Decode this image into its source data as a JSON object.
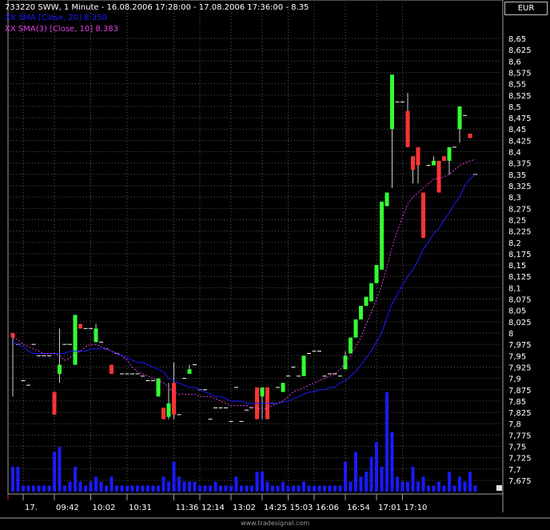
{
  "legend": {
    "title": "733220  SWW, 1 Minute - 16.08.2006 17:28:00 - 17.08.2006 17:36:00 - 8.35",
    "sma20": "XX SMA [Close, 20] 8.350",
    "sma10": "XX SMA(3) [Close, 10] 8.383"
  },
  "currency": "EUR",
  "watermark": "www.tradesignal.com",
  "colors": {
    "background": "#000000",
    "up": "#33ff33",
    "down": "#ff3333",
    "volume": "#1a1aff",
    "sma20": "#1a1aff",
    "sma10": "#e040e0",
    "grid": "#5a5a5a"
  },
  "chart_data": {
    "type": "candlestick",
    "title": "733220  SWW, 1 Minute - 16.08.2006 17:28:00 - 17.08.2006 17:36:00 - 8.35",
    "y_ticks": [
      "8,65",
      "8,625",
      "8,6",
      "8,575",
      "8,55",
      "8,525",
      "8,5",
      "8,475",
      "8,45",
      "8,425",
      "8,4",
      "8,375",
      "8,35",
      "8,325",
      "8,3",
      "8,275",
      "8,25",
      "8,225",
      "8,2",
      "8,175",
      "8,15",
      "8,125",
      "8,1",
      "8,075",
      "8,05",
      "8,025",
      "8",
      "7,975",
      "7,95",
      "7,925",
      "7,9",
      "7,875",
      "7,85",
      "7,825",
      "7,8",
      "7,775",
      "7,75",
      "7,725",
      "7,7",
      "7,675"
    ],
    "ylim": [
      7.66,
      8.67
    ],
    "x_ticks": [
      {
        "label": "17.",
        "index": 2
      },
      {
        "label": "09:42",
        "index": 8
      },
      {
        "label": "10:02",
        "index": 15
      },
      {
        "label": "10:31",
        "index": 22
      },
      {
        "label": "11:36",
        "index": 31
      },
      {
        "label": "12:14",
        "index": 36
      },
      {
        "label": "13:02",
        "index": 42
      },
      {
        "label": "14:25",
        "index": 48
      },
      {
        "label": "15:03",
        "index": 53
      },
      {
        "label": "16:06",
        "index": 58
      },
      {
        "label": "16:54",
        "index": 64
      },
      {
        "label": "17:01",
        "index": 70
      },
      {
        "label": "17:10",
        "index": 75
      }
    ],
    "candles": [
      [
        8.0,
        8.0,
        7.86,
        7.99
      ],
      [
        7.975,
        7.975,
        7.975,
        7.975
      ],
      [
        7.895,
        7.895,
        7.895,
        7.895
      ],
      [
        7.885,
        7.885,
        7.885,
        7.885
      ],
      [
        7.975,
        7.975,
        7.975,
        7.975
      ],
      [
        7.95,
        7.95,
        7.95,
        7.95
      ],
      [
        7.95,
        7.95,
        7.95,
        7.95
      ],
      [
        7.95,
        7.95,
        7.95,
        7.95
      ],
      [
        7.87,
        7.87,
        7.82,
        7.82
      ],
      [
        7.91,
        8.01,
        7.89,
        7.93
      ],
      [
        7.975,
        7.975,
        7.975,
        7.975
      ],
      [
        7.975,
        7.975,
        7.975,
        7.975
      ],
      [
        7.93,
        8.04,
        7.93,
        8.04
      ],
      [
        8.02,
        8.02,
        8.01,
        8.01
      ],
      [
        8.01,
        8.01,
        8.01,
        8.01
      ],
      [
        8.01,
        8.01,
        8.01,
        8.01
      ],
      [
        7.98,
        8.02,
        7.98,
        8.01
      ],
      [
        7.98,
        7.98,
        7.98,
        7.98
      ],
      [
        7.965,
        7.965,
        7.965,
        7.965
      ],
      [
        7.93,
        7.93,
        7.91,
        7.91
      ],
      [
        7.955,
        7.955,
        7.955,
        7.955
      ],
      [
        7.91,
        7.91,
        7.91,
        7.91
      ],
      [
        7.91,
        7.91,
        7.91,
        7.91
      ],
      [
        7.91,
        7.91,
        7.91,
        7.91
      ],
      [
        7.91,
        7.91,
        7.91,
        7.91
      ],
      [
        7.905,
        7.905,
        7.905,
        7.905
      ],
      [
        7.895,
        7.895,
        7.895,
        7.895
      ],
      [
        7.895,
        7.895,
        7.895,
        7.895
      ],
      [
        7.86,
        7.9,
        7.86,
        7.9
      ],
      [
        7.835,
        7.835,
        7.81,
        7.81
      ],
      [
        7.815,
        7.89,
        7.81,
        7.845
      ],
      [
        7.89,
        7.935,
        7.81,
        7.82
      ],
      [
        7.82,
        7.82,
        7.82,
        7.82
      ],
      [
        7.9,
        7.9,
        7.9,
        7.9
      ],
      [
        7.91,
        7.93,
        7.91,
        7.92
      ],
      [
        7.93,
        7.93,
        7.93,
        7.93
      ],
      [
        7.875,
        7.875,
        7.875,
        7.875
      ],
      [
        7.875,
        7.875,
        7.875,
        7.875
      ],
      [
        7.81,
        7.81,
        7.81,
        7.81
      ],
      [
        7.835,
        7.835,
        7.835,
        7.835
      ],
      [
        7.835,
        7.835,
        7.835,
        7.835
      ],
      [
        7.835,
        7.835,
        7.835,
        7.835
      ],
      [
        7.805,
        7.805,
        7.805,
        7.805
      ],
      [
        7.88,
        7.88,
        7.88,
        7.88
      ],
      [
        7.805,
        7.805,
        7.805,
        7.805
      ],
      [
        7.83,
        7.83,
        7.83,
        7.83
      ],
      [
        7.835,
        7.835,
        7.835,
        7.835
      ],
      [
        7.88,
        7.88,
        7.81,
        7.81
      ],
      [
        7.86,
        7.88,
        7.81,
        7.88
      ],
      [
        7.88,
        7.88,
        7.81,
        7.81
      ],
      [
        7.845,
        7.845,
        7.845,
        7.845
      ],
      [
        7.88,
        7.88,
        7.88,
        7.88
      ],
      [
        7.87,
        7.89,
        7.87,
        7.89
      ],
      [
        7.905,
        7.905,
        7.905,
        7.905
      ],
      [
        7.925,
        7.925,
        7.925,
        7.925
      ],
      [
        7.905,
        7.905,
        7.905,
        7.905
      ],
      [
        7.905,
        7.95,
        7.905,
        7.95
      ],
      [
        7.955,
        7.955,
        7.955,
        7.955
      ],
      [
        7.96,
        7.96,
        7.96,
        7.96
      ],
      [
        7.96,
        7.96,
        7.96,
        7.96
      ],
      [
        7.905,
        7.905,
        7.905,
        7.905
      ],
      [
        7.91,
        7.91,
        7.91,
        7.91
      ],
      [
        7.91,
        7.91,
        7.91,
        7.91
      ],
      [
        7.905,
        7.905,
        7.905,
        7.905
      ],
      [
        7.92,
        7.96,
        7.92,
        7.95
      ],
      [
        7.955,
        7.99,
        7.955,
        7.99
      ],
      [
        7.99,
        8.03,
        7.99,
        8.03
      ],
      [
        8.03,
        8.06,
        8.03,
        8.06
      ],
      [
        8.06,
        8.08,
        8.06,
        8.08
      ],
      [
        8.07,
        8.11,
        8.07,
        8.11
      ],
      [
        8.11,
        8.15,
        8.11,
        8.15
      ],
      [
        8.14,
        8.29,
        8.14,
        8.29
      ],
      [
        8.28,
        8.31,
        8.28,
        8.31
      ],
      [
        8.45,
        8.57,
        8.32,
        8.57
      ],
      [
        8.51,
        8.51,
        8.51,
        8.51
      ],
      [
        8.51,
        8.51,
        8.51,
        8.51
      ],
      [
        8.49,
        8.53,
        8.41,
        8.41
      ],
      [
        8.39,
        8.39,
        8.33,
        8.36
      ],
      [
        8.41,
        8.41,
        8.33,
        8.37
      ],
      [
        8.31,
        8.31,
        8.21,
        8.21
      ],
      [
        8.37,
        8.37,
        8.37,
        8.37
      ],
      [
        8.37,
        8.39,
        8.37,
        8.38
      ],
      [
        8.38,
        8.38,
        8.31,
        8.31
      ],
      [
        8.39,
        8.39,
        8.38,
        8.38
      ],
      [
        8.38,
        8.39,
        8.35,
        8.41
      ],
      [
        8.41,
        8.41,
        8.41,
        8.41
      ],
      [
        8.45,
        8.5,
        8.42,
        8.5
      ],
      [
        8.48,
        8.48,
        8.48,
        8.48
      ],
      [
        8.44,
        8.44,
        8.43,
        8.43
      ],
      [
        8.35,
        8.35,
        8.35,
        8.35
      ]
    ],
    "volumes": [
      0.25,
      0.25,
      0.06,
      0.06,
      0.06,
      0.06,
      0.06,
      0.06,
      0.4,
      0.45,
      0.06,
      0.1,
      0.25,
      0.1,
      0.06,
      0.1,
      0.15,
      0.1,
      0.06,
      0.15,
      0.06,
      0.06,
      0.06,
      0.06,
      0.06,
      0.06,
      0.06,
      0.06,
      0.06,
      0.15,
      0.1,
      0.3,
      0.15,
      0.1,
      0.1,
      0.1,
      0.06,
      0.06,
      0.06,
      0.1,
      0.06,
      0.06,
      0.06,
      0.15,
      0.06,
      0.06,
      0.06,
      0.2,
      0.2,
      0.1,
      0.06,
      0.06,
      0.1,
      0.06,
      0.06,
      0.06,
      0.1,
      0.06,
      0.06,
      0.06,
      0.06,
      0.06,
      0.06,
      0.06,
      0.3,
      0.1,
      0.4,
      0.15,
      0.2,
      0.35,
      0.5,
      0.25,
      1.0,
      0.6,
      0.15,
      0.1,
      0.1,
      0.25,
      0.1,
      0.15,
      0.06,
      0.06,
      0.1,
      0.06,
      0.2,
      0.06,
      0.15,
      0.1,
      0.2,
      0.06
    ],
    "sma20": [
      7.98,
      7.975,
      7.97,
      7.96,
      7.955,
      7.955,
      7.955,
      7.955,
      7.955,
      7.955,
      7.955,
      7.96,
      7.96,
      7.96,
      7.96,
      7.965,
      7.965,
      7.965,
      7.965,
      7.96,
      7.955,
      7.95,
      7.945,
      7.94,
      7.935,
      7.935,
      7.93,
      7.925,
      7.92,
      7.915,
      7.9,
      7.895,
      7.89,
      7.885,
      7.88,
      7.88,
      7.875,
      7.87,
      7.865,
      7.86,
      7.86,
      7.855,
      7.85,
      7.85,
      7.85,
      7.845,
      7.845,
      7.845,
      7.845,
      7.845,
      7.845,
      7.845,
      7.848,
      7.85,
      7.855,
      7.86,
      7.865,
      7.87,
      7.87,
      7.875,
      7.875,
      7.88,
      7.88,
      7.89,
      7.895,
      7.905,
      7.915,
      7.93,
      7.945,
      7.96,
      7.98,
      8.0,
      8.035,
      8.065,
      8.085,
      8.105,
      8.125,
      8.14,
      8.16,
      8.185,
      8.2,
      8.22,
      8.23,
      8.25,
      8.265,
      8.285,
      8.3,
      8.325,
      8.34,
      8.35
    ],
    "sma10": [
      7.99,
      7.985,
      7.975,
      7.97,
      7.965,
      7.96,
      7.955,
      7.955,
      7.955,
      7.95,
      7.94,
      7.945,
      7.955,
      7.96,
      7.97,
      7.975,
      7.975,
      7.97,
      7.965,
      7.96,
      7.955,
      7.95,
      7.94,
      7.925,
      7.915,
      7.91,
      7.905,
      7.9,
      7.895,
      7.89,
      7.88,
      7.87,
      7.865,
      7.865,
      7.865,
      7.865,
      7.86,
      7.86,
      7.86,
      7.855,
      7.85,
      7.845,
      7.84,
      7.84,
      7.84,
      7.84,
      7.835,
      7.835,
      7.83,
      7.835,
      7.84,
      7.845,
      7.85,
      7.86,
      7.87,
      7.875,
      7.88,
      7.885,
      7.89,
      7.895,
      7.9,
      7.905,
      7.91,
      7.92,
      7.935,
      7.95,
      7.97,
      7.99,
      8.02,
      8.045,
      8.075,
      8.105,
      8.145,
      8.19,
      8.225,
      8.255,
      8.285,
      8.3,
      8.31,
      8.32,
      8.33,
      8.34,
      8.34,
      8.345,
      8.35,
      8.36,
      8.37,
      8.375,
      8.38,
      8.383
    ]
  }
}
